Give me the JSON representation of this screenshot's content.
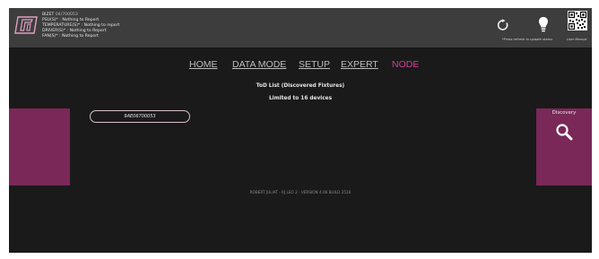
{
  "header": {
    "serial_label": "BIZET",
    "serial_value": "04/700053",
    "status_lines": [
      "PSU(S)* : Nothing to Report",
      "TEMPERATURE(S)* : Nothing to report",
      "DRIVER(S)* : Nothing to Report",
      "FAN(S)* : Nothing to Report"
    ],
    "refresh_note": "*Press refresh to update status",
    "manual_label": "User Manual",
    "icons": [
      "logo-icon",
      "refresh-icon",
      "bulb-icon",
      "qr-code-icon"
    ]
  },
  "nav": {
    "items": [
      "HOME",
      "DATA MODE",
      "SETUP",
      "EXPERT",
      "NODE"
    ],
    "active": "NODE",
    "active_color": "#d93a9a"
  },
  "tod": {
    "title": "ToD List (Discovered Fixtures)",
    "limit": "Limited to 16 devices"
  },
  "devices": [
    "9AE06700053"
  ],
  "discovery": {
    "label": "Discovery",
    "icon": "search-icon"
  },
  "footer": "ROBERT JULIAT  -  RJ LEO 2  -  VERSION 4.06 BUILD 2516",
  "colors": {
    "panel": "#7a2858",
    "background": "#1a1a1a",
    "header": "#3d3d3d"
  }
}
